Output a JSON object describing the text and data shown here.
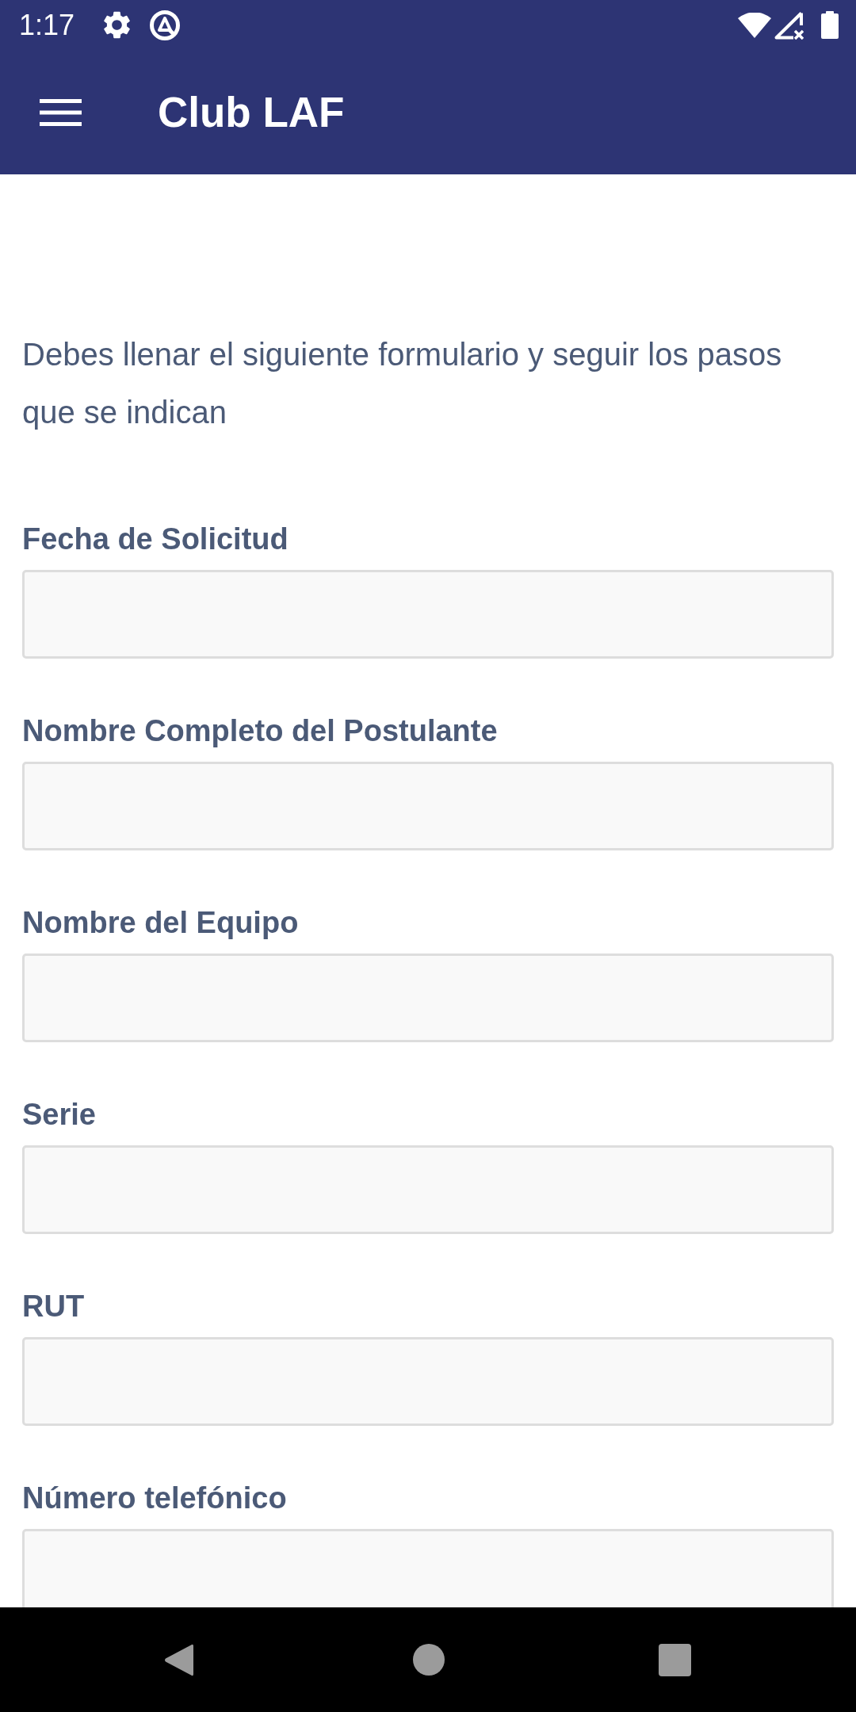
{
  "status_bar": {
    "time": "1:17"
  },
  "app_bar": {
    "title": "Club LAF"
  },
  "intro": "Debes llenar el siguiente formulario y seguir los pasos que se indican",
  "fields": [
    {
      "label": "Fecha de Solicitud"
    },
    {
      "label": "Nombre Completo del Postulante"
    },
    {
      "label": "Nombre del Equipo"
    },
    {
      "label": "Serie"
    },
    {
      "label": "RUT"
    },
    {
      "label": "Número telefónico"
    }
  ]
}
